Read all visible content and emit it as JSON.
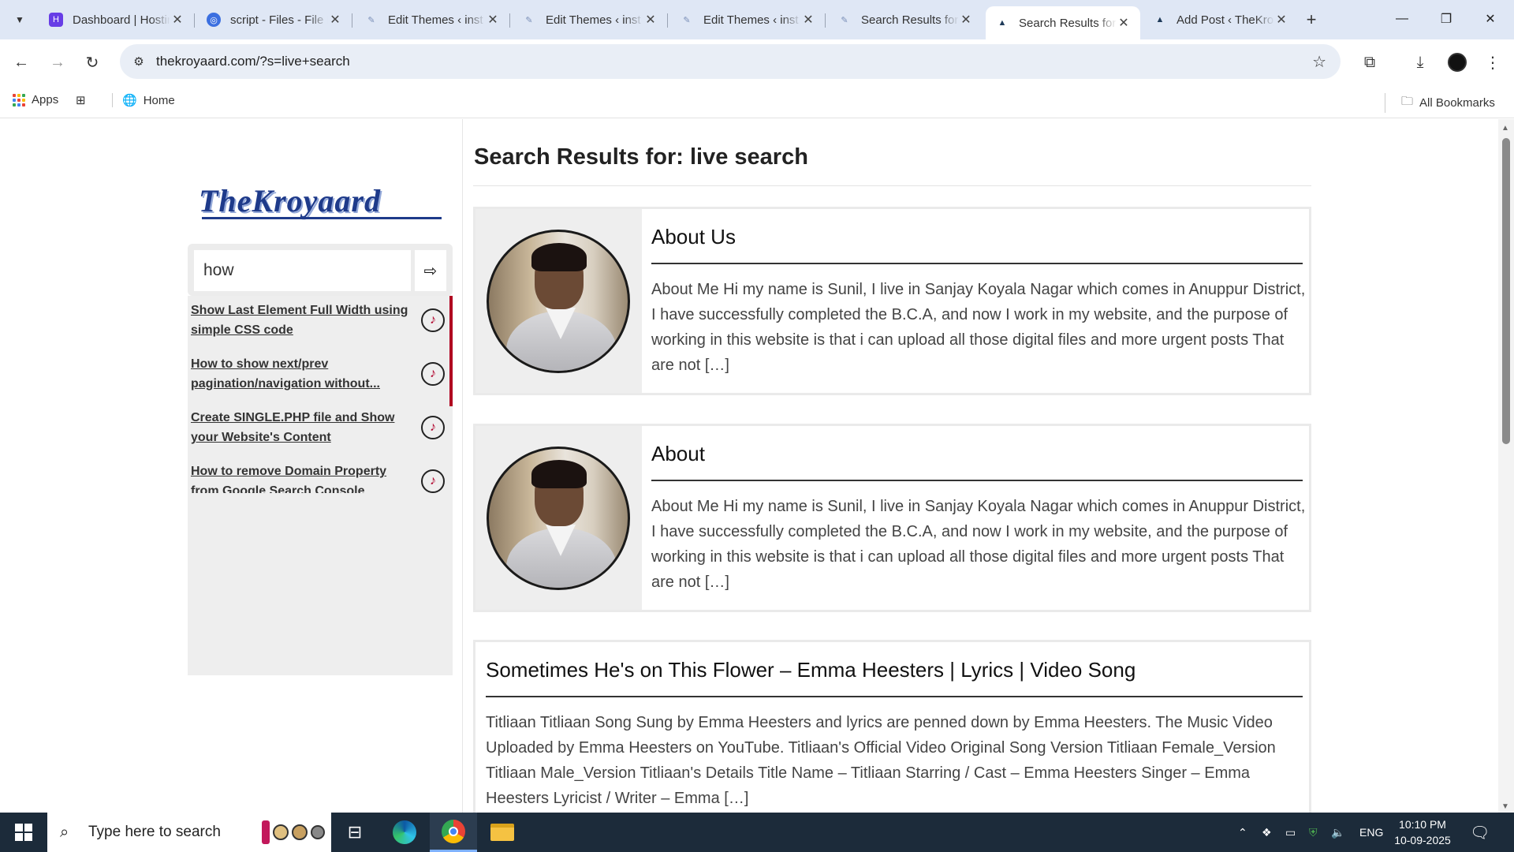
{
  "browser": {
    "tabs": [
      {
        "title": "Dashboard | Hostinger",
        "icon": "hostinger-icon",
        "color": "#673de6"
      },
      {
        "title": "script - Files - File Manager",
        "icon": "file-manager-icon",
        "color": "#3b6fe0"
      },
      {
        "title": "Edit Themes ‹ inst",
        "icon": "wordpress-icon",
        "color": "#7a8fb8"
      },
      {
        "title": "Edit Themes ‹ inst",
        "icon": "wordpress-icon",
        "color": "#7a8fb8"
      },
      {
        "title": "Edit Themes ‹ inst",
        "icon": "wordpress-icon",
        "color": "#7a8fb8"
      },
      {
        "title": "Search Results for",
        "icon": "wordpress-icon",
        "color": "#7a8fb8"
      },
      {
        "title": "Search Results for",
        "icon": "site-icon",
        "color": "#1f3b5a"
      },
      {
        "title": "Add Post ‹ TheKroyaard",
        "icon": "site-icon",
        "color": "#1f3b5a"
      }
    ],
    "active_tab": 6,
    "url": "thekroyaard.com/?s=live+search",
    "bookmarks": {
      "apps": "Apps",
      "home": "Home",
      "all": "All Bookmarks"
    }
  },
  "site": {
    "logo_text": "TheKroyaard",
    "search_value": "how",
    "suggestions": [
      "Show Last Element Full Width using simple CSS code",
      "How to show next/prev pagination/navigation without...",
      "Create SINGLE.PHP file and Show your Website's Content",
      "How to remove Domain Property from Google Search Console"
    ],
    "page_title": "Search Results for: live search",
    "results": [
      {
        "title": "About Us",
        "excerpt": "About Me Hi my name is Sunil, I live in Sanjay Koyala Nagar which comes in Anuppur District, I have successfully completed the B.C.A, and now I work in my website, and the purpose of working in this website is that i can upload all those digital files and more urgent posts That are not […]"
      },
      {
        "title": "About",
        "excerpt": "About Me Hi my name is Sunil, I live in Sanjay Koyala Nagar which comes in Anuppur District, I have successfully completed the B.C.A, and now I work in my website, and the purpose of working in this website is that i can upload all those digital files and more urgent posts That are not […]"
      },
      {
        "title": "Sometimes He's on This Flower – Emma Heesters | Lyrics | Video Song",
        "excerpt": "Titliaan Titliaan Song Sung by Emma Heesters and lyrics are penned down by Emma Heesters. The Music Video Uploaded by Emma Heesters on YouTube. Titliaan's Official Video  Original Song Version Titliaan Female_Version Titliaan Male_Version Titliaan's Details Title Name – Titliaan Starring / Cast – Emma Heesters Singer – Emma Heesters Lyricist / Writer – Emma […]"
      }
    ]
  },
  "taskbar": {
    "search_placeholder": "Type here to search",
    "language": "ENG",
    "time": "10:10 PM",
    "date": "10-09-2025"
  }
}
